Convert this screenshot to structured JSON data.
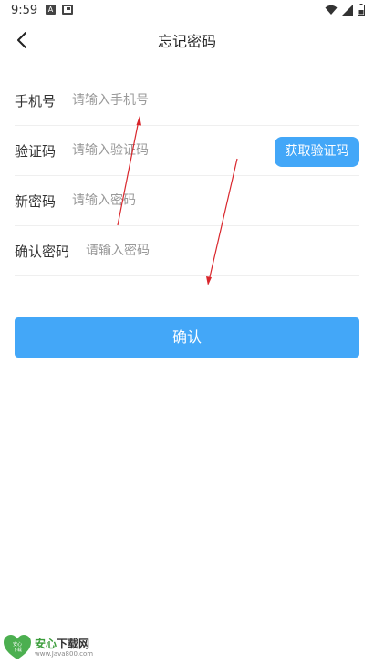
{
  "status_bar": {
    "time": "9:59",
    "a_badge": "A"
  },
  "header": {
    "title": "忘记密码"
  },
  "form": {
    "phone": {
      "label": "手机号",
      "placeholder": "请输入手机号"
    },
    "code": {
      "label": "验证码",
      "placeholder": "请输入验证码",
      "button_label": "获取验证码"
    },
    "new_password": {
      "label": "新密码",
      "placeholder": "请输入密码"
    },
    "confirm_password": {
      "label": "确认密码",
      "placeholder": "请输入密码"
    }
  },
  "confirm_button": {
    "label": "确认"
  },
  "watermark": {
    "logo_text_top": "安心",
    "logo_text_bottom": "下载",
    "title_green": "安心",
    "title_dark": "下载网",
    "url": "www.Java800.com"
  },
  "colors": {
    "accent": "#43a7f8",
    "annotation_arrow": "#d9262c",
    "watermark_green": "#3b9d3b"
  },
  "icons": {
    "back": "chevron-left-icon",
    "wifi": "wifi-icon",
    "signal": "signal-icon",
    "battery": "battery-icon"
  }
}
